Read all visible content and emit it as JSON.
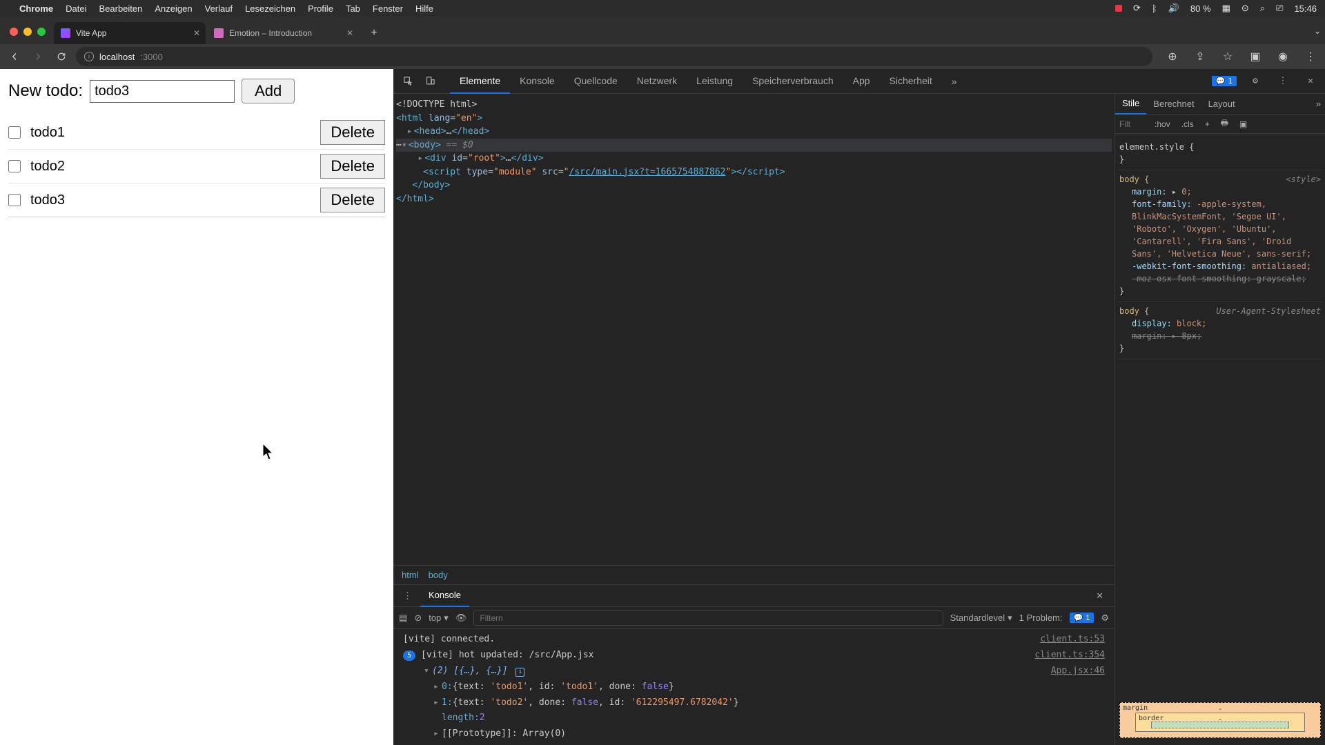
{
  "menubar": {
    "app": "Chrome",
    "items": [
      "Datei",
      "Bearbeiten",
      "Anzeigen",
      "Verlauf",
      "Lesezeichen",
      "Profile",
      "Tab",
      "Fenster",
      "Hilfe"
    ],
    "battery": "80 %",
    "clock": "15:46"
  },
  "tabs": [
    {
      "title": "Vite App"
    },
    {
      "title": "Emotion – Introduction"
    }
  ],
  "url": {
    "host": "localhost",
    "path": ":3000"
  },
  "app": {
    "label": "New todo:",
    "input_value": "todo3",
    "add": "Add",
    "delete": "Delete",
    "todos": [
      {
        "text": "todo1"
      },
      {
        "text": "todo2"
      },
      {
        "text": "todo3"
      }
    ]
  },
  "devtools": {
    "tabs": [
      "Elemente",
      "Konsole",
      "Quellcode",
      "Netzwerk",
      "Leistung",
      "Speicherverbrauch",
      "App",
      "Sicherheit"
    ],
    "issue_count": "1",
    "dom": {
      "doctype": "<!DOCTYPE html>",
      "html_open": "<html lang=\"en\">",
      "head": "<head>…</head>",
      "body_open": "<body>",
      "eq0": " == $0",
      "root": "<div id=\"root\">…</div>",
      "script": "<script type=\"module\" src=\"/src/main.jsx?t=1665754887862\"></script>",
      "script_src": "/src/main.jsx?t=1665754887862",
      "body_close": "</body>",
      "html_close": "</html>"
    },
    "crumbs": [
      "html",
      "body"
    ],
    "styles_tabs": [
      "Stile",
      "Berechnet",
      "Layout"
    ],
    "filter_placeholder": "Filt",
    "hov": ":hov",
    "cls": ".cls",
    "rules": {
      "element_style": "element.style {",
      "close": "}",
      "body_sel": "body {",
      "stylesrc": "<style>",
      "margin": "margin:",
      "margin_v": "0;",
      "ff": "font-family:",
      "ff_v": "-apple-system, BlinkMacSystemFont, 'Segoe UI', 'Roboto', 'Oxygen', 'Ubuntu', 'Cantarell', 'Fira Sans', 'Droid Sans', 'Helvetica Neue', sans-serif;",
      "wfs": "-webkit-font-smoothing:",
      "wfs_v": "antialiased;",
      "mfs": "-moz-osx-font-smoothing:",
      "mfs_v": "grayscale;",
      "ua_src": "User-Agent-Stylesheet",
      "display": "display:",
      "display_v": "block;",
      "margin2": "margin:",
      "margin2_v": "8px;"
    },
    "boxmodel": {
      "margin": "margin",
      "border": "border",
      "dash": "-"
    }
  },
  "drawer": {
    "tab": "Konsole",
    "context": "top",
    "filter_placeholder": "Filtern",
    "level": "Standardlevel",
    "problems_label": "1 Problem:",
    "problems_count": "1",
    "lines": {
      "l1": "[vite] connected.",
      "l1s": "client.ts:53",
      "l2": "[vite] hot updated: /src/App.jsx",
      "l2s": "client.ts:354",
      "l2b": "5",
      "l3": "(2) [{…}, {…}]",
      "l3s": "App.jsx:46",
      "l4a": "0:",
      "l4b": "{text: 'todo1', id: 'todo1', done: false}",
      "l5a": "1:",
      "l5b": "{text: 'todo2', done: false, id: '612295497.6782042'}",
      "l6a": "length:",
      "l6b": "2",
      "l7": "[[Prototype]]: Array(0)"
    }
  }
}
